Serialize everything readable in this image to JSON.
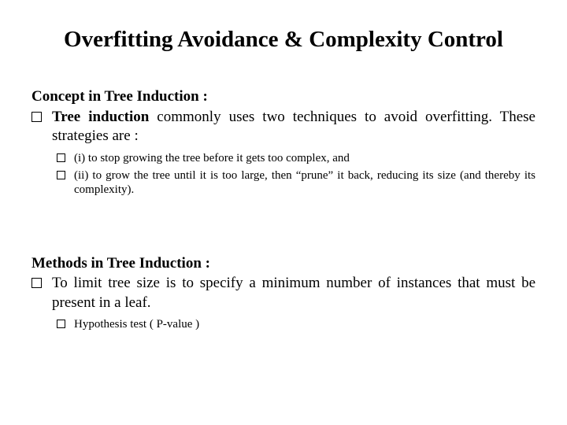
{
  "title": "Overfitting Avoidance & Complexity Control",
  "sections": [
    {
      "label": "Concept in Tree Induction :",
      "point_lead": "Tree induction",
      "point_rest": " commonly uses two techniques to avoid overfitting.  These strategies are :",
      "subpoints": [
        "(i) to stop growing the tree before it gets too complex, and",
        "(ii) to grow the tree until it is too large, then “prune” it back, reducing its size (and thereby its complexity)."
      ]
    },
    {
      "label": "Methods in Tree Induction :",
      "point_lead": "",
      "point_rest": "To limit tree size is to specify a minimum number of instances that must be present in a leaf.",
      "subpoints": [
        "Hypothesis test ( P-value )"
      ]
    }
  ]
}
